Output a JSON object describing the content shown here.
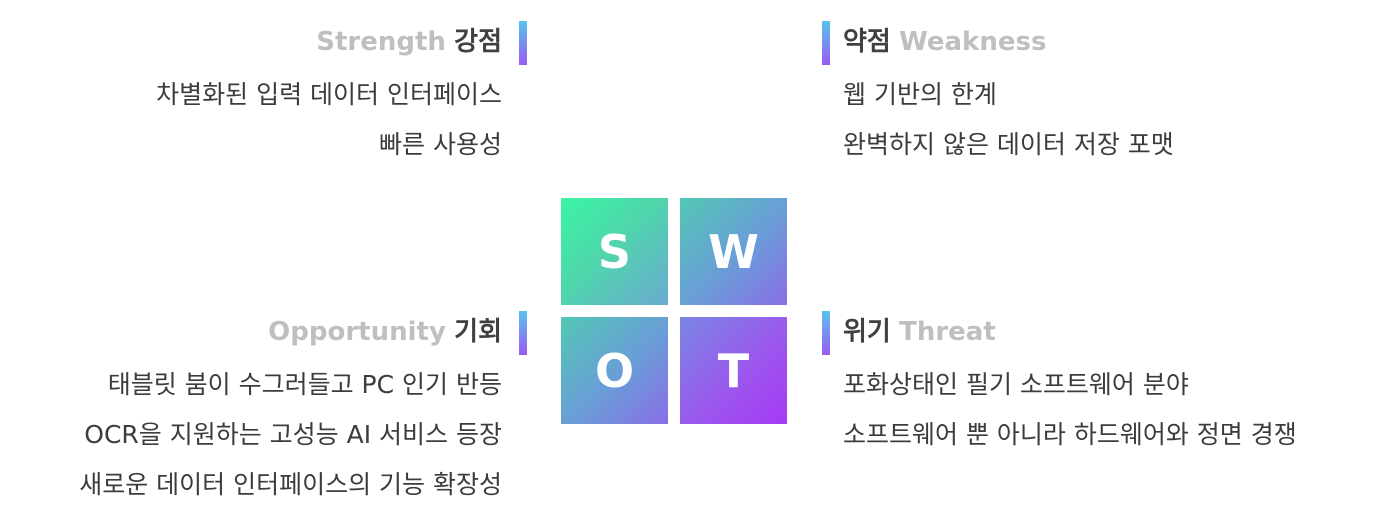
{
  "swot": {
    "tiles": {
      "s": "S",
      "w": "W",
      "o": "O",
      "t": "T"
    },
    "strength": {
      "en": "Strength",
      "ko": "강점",
      "items": [
        "차별화된 입력 데이터 인터페이스",
        "빠른 사용성"
      ]
    },
    "weakness": {
      "en": "Weakness",
      "ko": "약점",
      "items": [
        "웹 기반의 한계",
        "완벽하지 않은 데이터 저장 포맷"
      ]
    },
    "opportunity": {
      "en": "Opportunity",
      "ko": "기회",
      "items": [
        "태블릿 붐이 수그러들고 PC 인기 반등",
        "OCR을 지원하는 고성능 AI 서비스 등장",
        "새로운 데이터 인터페이스의 기능 확장성"
      ]
    },
    "threat": {
      "en": "Threat",
      "ko": "위기",
      "items": [
        "포화상태인 필기 소프트웨어 분야",
        "소프트웨어 뿐 아니라 하드웨어와 정면 경쟁"
      ]
    }
  },
  "colors": {
    "accent_top": "#56c4f0",
    "accent_bottom": "#9a5bf0",
    "heading_en": "#bfbfbf",
    "heading_ko": "#404040",
    "body_text": "#3c3c3c"
  }
}
